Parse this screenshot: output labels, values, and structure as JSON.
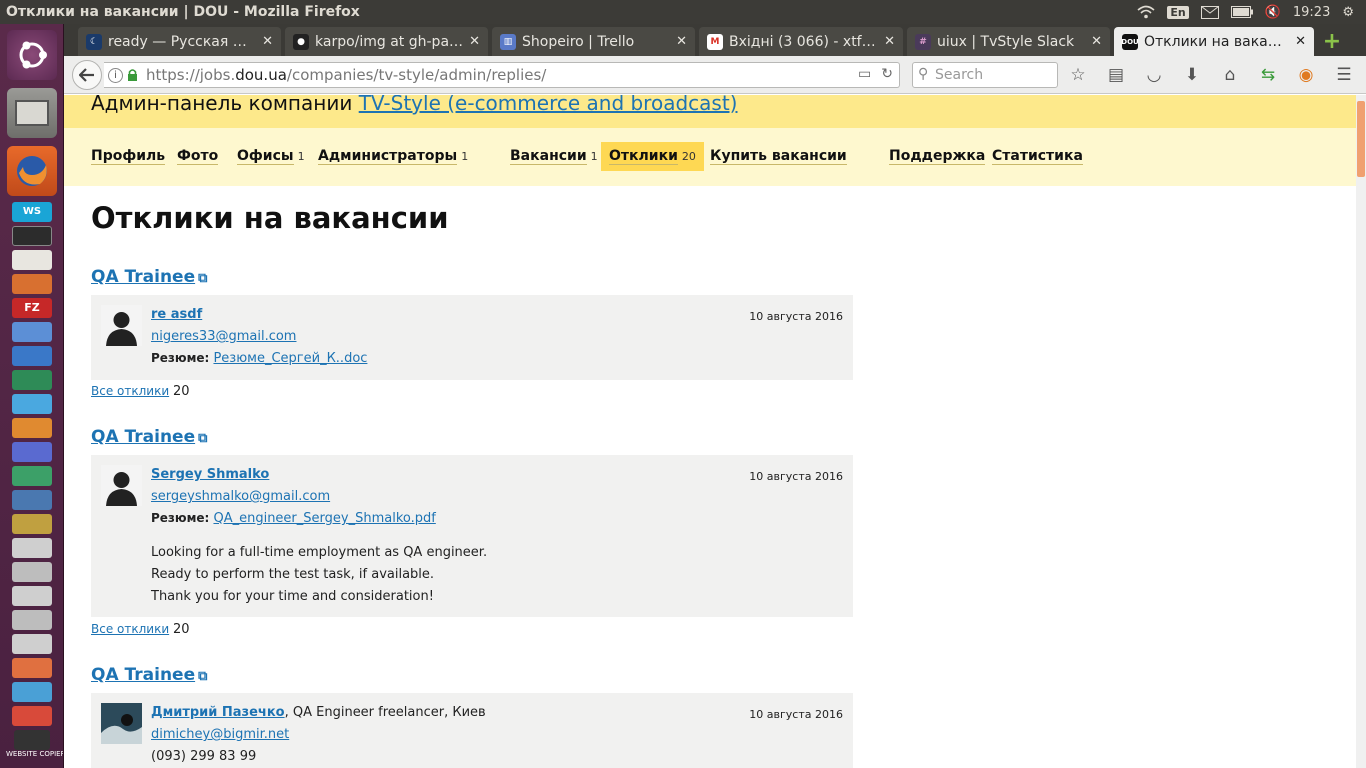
{
  "os": {
    "window_title": "Отклики на вакансии | DOU - Mozilla Firefox",
    "keyboard_layout": "En",
    "clock": "19:23"
  },
  "launcher": {
    "items": [
      "ubuntu-dash-icon",
      "files-icon",
      "firefox-icon",
      "webstorm-icon",
      "terminal-icon",
      "text-editor-icon",
      "impress-icon",
      "filezilla-icon",
      "remmina-icon",
      "writer-icon",
      "calc-icon",
      "skype-icon",
      "software-center-icon",
      "workspace-icon",
      "spreadsheet-icon",
      "sublime-icon",
      "stack-icon",
      "stack-icon",
      "stack-icon",
      "stack-icon",
      "website-copier-icon"
    ],
    "website_copier_label": "WEBSITE COPIER"
  },
  "tabs": [
    {
      "label": "ready — Русская д…",
      "icon": "dark-crescent-icon",
      "active": false
    },
    {
      "label": "karpo/img at gh-pa…",
      "icon": "github-icon",
      "active": false
    },
    {
      "label": "Shopeiro | Trello",
      "icon": "trello-icon",
      "active": false
    },
    {
      "label": "Вхідні (3 066) - xtfk…",
      "icon": "gmail-icon",
      "active": false
    },
    {
      "label": "uiux | TvStyle Slack",
      "icon": "slack-icon",
      "active": false
    },
    {
      "label": "Отклики на ваканс…",
      "icon": "dou-icon",
      "active": true
    }
  ],
  "navbar": {
    "url_prefix": "https://jobs.",
    "url_domain": "dou.ua",
    "url_path": "/companies/tv-style/admin/replies/",
    "search_placeholder": "Search"
  },
  "company": {
    "prefix": "Админ-панель компании ",
    "name": "TV-Style (e-commerce and broadcast)"
  },
  "subnav": [
    {
      "label": "Профиль",
      "count": ""
    },
    {
      "label": "Фото",
      "count": ""
    },
    {
      "label": "Офисы",
      "count": "1"
    },
    {
      "label": "Администраторы",
      "count": "1"
    },
    {
      "label": "Вакансии",
      "count": "1"
    },
    {
      "label": "Отклики",
      "count": "20",
      "active": true
    },
    {
      "label": "Купить вакансии",
      "count": ""
    },
    {
      "label": "Поддержка",
      "count": ""
    },
    {
      "label": "Статистика",
      "count": ""
    }
  ],
  "page_title": "Отклики на вакансии",
  "resume_label": "Резюме:",
  "all_replies_label": "Все отклики",
  "vacancies": [
    {
      "title": "QA Trainee",
      "reply": {
        "name": "re asdf",
        "extra": "",
        "email": "nigeres33@gmail.com",
        "date": "10 августа 2016",
        "resume_file": "Резюме_Сергей_К..doc",
        "message": []
      },
      "all_count": "20"
    },
    {
      "title": "QA Trainee",
      "reply": {
        "name": "Sergey Shmalko",
        "extra": "",
        "email": "sergeyshmalko@gmail.com",
        "date": "10 августа 2016",
        "resume_file": "QA_engineer_Sergey_Shmalko.pdf",
        "message": [
          "Looking for a full-time employment as QA engineer.",
          "Ready to perform the test task, if available.",
          "Thank you for your time and consideration!"
        ]
      },
      "all_count": "20"
    },
    {
      "title": "QA Trainee",
      "reply": {
        "name": "Дмитрий Пазечко",
        "extra": ", QA Engineer freelancer, Киев",
        "email": "dimichey@bigmir.net",
        "phone": "(093) 299 83 99",
        "date": "10 августа 2016"
      }
    }
  ]
}
